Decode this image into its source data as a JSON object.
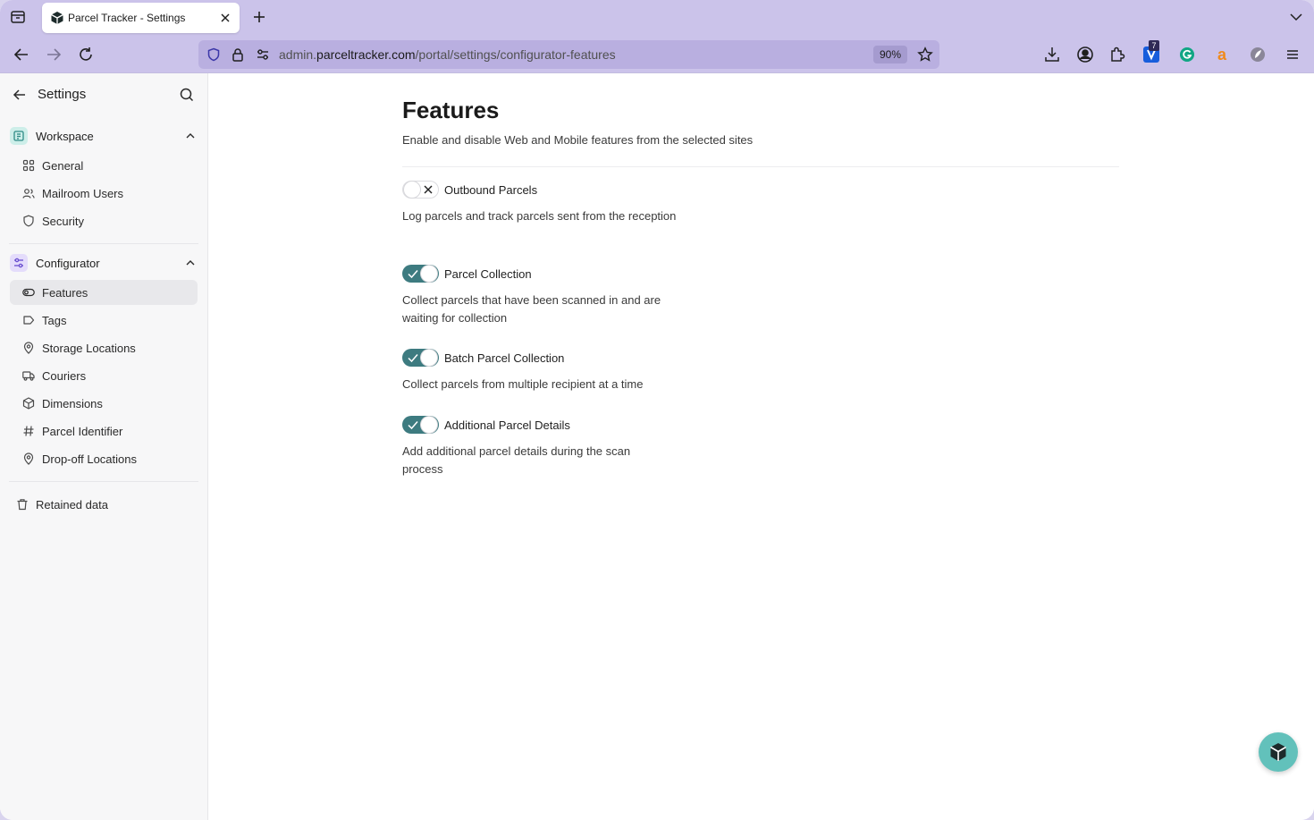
{
  "browser": {
    "tab": {
      "title": "Parcel Tracker - Settings"
    },
    "url": {
      "prefix": "admin.",
      "host": "parceltracker.com",
      "path": "/portal/settings/configurator-features"
    },
    "zoom": "90%",
    "extension_badge": "7"
  },
  "sidebar": {
    "title": "Settings",
    "groups": [
      {
        "label": "Workspace",
        "items": [
          {
            "label": "General",
            "icon": "grid-icon"
          },
          {
            "label": "Mailroom Users",
            "icon": "users-icon"
          },
          {
            "label": "Security",
            "icon": "shield-icon"
          }
        ]
      },
      {
        "label": "Configurator",
        "items": [
          {
            "label": "Features",
            "icon": "toggle-icon",
            "active": true
          },
          {
            "label": "Tags",
            "icon": "tag-icon"
          },
          {
            "label": "Storage Locations",
            "icon": "map-pin-icon"
          },
          {
            "label": "Couriers",
            "icon": "truck-icon"
          },
          {
            "label": "Dimensions",
            "icon": "box-icon"
          },
          {
            "label": "Parcel Identifier",
            "icon": "hash-icon"
          },
          {
            "label": "Drop-off Locations",
            "icon": "map-pin-icon"
          }
        ]
      }
    ],
    "retained": {
      "label": "Retained data",
      "icon": "trash-icon"
    }
  },
  "main": {
    "title": "Features",
    "subtitle": "Enable and disable Web and Mobile features from the selected sites",
    "features": [
      {
        "name": "Outbound Parcels",
        "enabled": false,
        "description": "Log parcels and track parcels sent from the reception"
      },
      {
        "name": "Parcel Collection",
        "enabled": true,
        "description": "Collect parcels that have been scanned in and are waiting for collection"
      },
      {
        "name": "Batch Parcel Collection",
        "enabled": true,
        "description": "Collect parcels from multiple recipient at a time"
      },
      {
        "name": "Additional Parcel Details",
        "enabled": true,
        "description": "Add additional parcel details during the scan process"
      }
    ]
  },
  "colors": {
    "toggle_on": "#3d7b80",
    "accent_workspace": "#cdeee9",
    "accent_configurator": "#e4dcfb",
    "fab": "#62c1bb",
    "browser_chrome": "#cbc3ea"
  }
}
